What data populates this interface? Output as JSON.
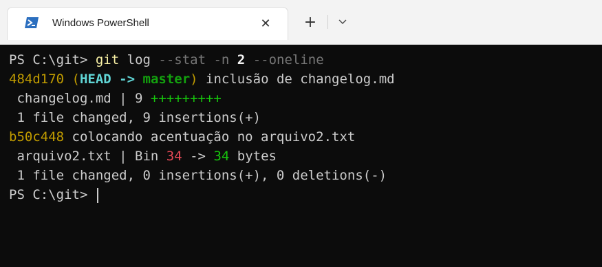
{
  "titlebar": {
    "tab_title": "Windows PowerShell",
    "close_symbol": "✕",
    "new_tab_symbol": "+"
  },
  "terminal": {
    "line1": {
      "prompt": "PS C:\\git> ",
      "cmd": "git",
      "sp1": " ",
      "sub": "log",
      "args1": " --stat -n ",
      "num": "2",
      "args2": " --oneline"
    },
    "line2": {
      "hash": "484d170",
      "sp": " ",
      "open": "(",
      "head": "HEAD -> ",
      "branch": "master",
      "close": ")",
      "msg": " inclusão de changelog.md"
    },
    "line3": {
      "stat": " changelog.md | 9 ",
      "plus": "+++++++++"
    },
    "line4": {
      "text": " 1 file changed, 9 insertions(+)"
    },
    "line5": {
      "hash": "b50c448",
      "msg": " colocando acentuação no arquivo2.txt"
    },
    "line6": {
      "pre": " arquivo2.txt | Bin ",
      "from": "34",
      "arrow": " -> ",
      "to": "34",
      "post": " bytes"
    },
    "line7": {
      "text": " 1 file changed, 0 insertions(+), 0 deletions(-)"
    },
    "line8": {
      "prompt": "PS C:\\git> "
    }
  },
  "colors": {
    "terminal_bg": "#0c0c0c",
    "titlebar_bg": "#f3f3f3",
    "hash": "#c19c00",
    "head": "#3a96dd",
    "branch": "#13a10e",
    "insertions": "#16c60c",
    "deletions": "#e74856"
  },
  "icons": {
    "tab_icon": "powershell-icon",
    "close": "close-icon",
    "new_tab": "plus-icon",
    "dropdown": "chevron-down-icon"
  }
}
